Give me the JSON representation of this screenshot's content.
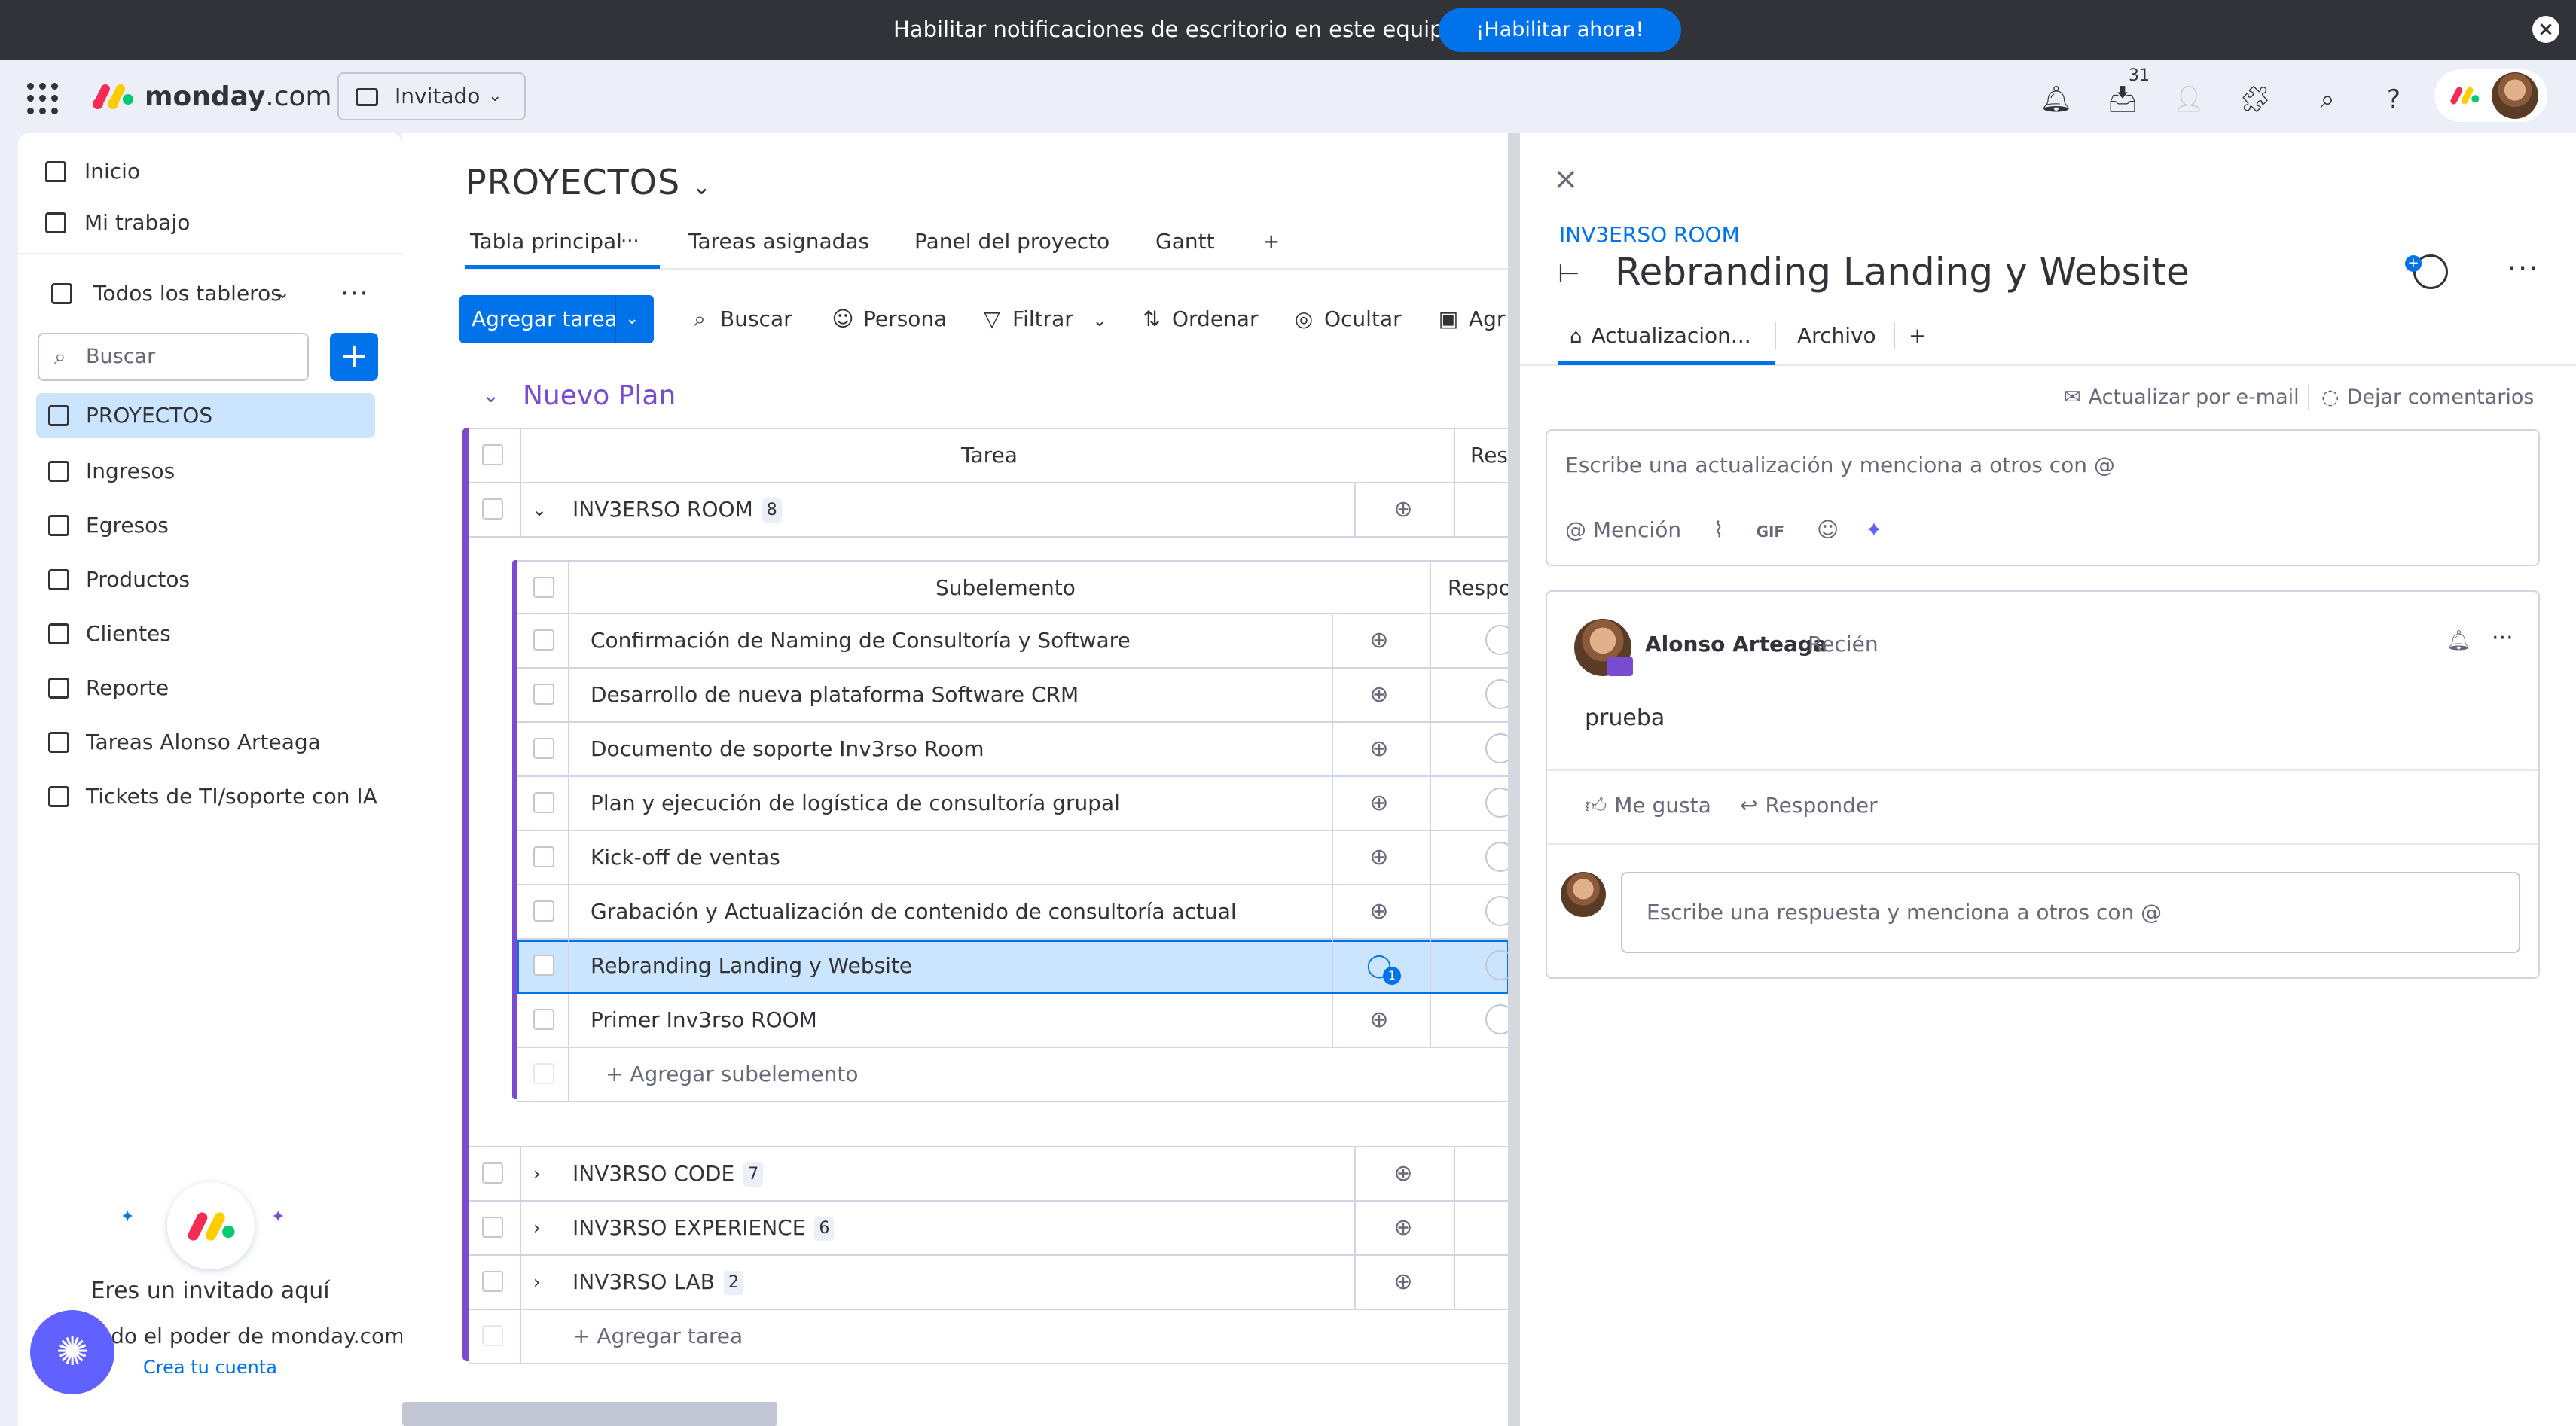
{
  "banner": {
    "message": "Habilitar notificaciones de escritorio en este equipo",
    "cta": "¡Habilitar ahora!"
  },
  "header": {
    "logo": "monday",
    "logo_suffix": ".com",
    "workspace": "Invitado",
    "inbox_count": "31"
  },
  "sidebar": {
    "home": "Inicio",
    "my_work": "Mi trabajo",
    "boards_selector": "Todos los tableros",
    "search_placeholder": "Buscar",
    "items": [
      "PROYECTOS",
      "Ingresos",
      "Egresos",
      "Productos",
      "Clientes",
      "Reporte",
      "Tareas Alonso Arteaga",
      "Tickets de TI/soporte con IA"
    ],
    "guest_line1": "Eres un invitado aquí",
    "guest_line2": "odo el poder de monday.com",
    "guest_link": "Crea tu cuenta"
  },
  "board": {
    "title": "PROYECTOS",
    "tabs": [
      "Tabla principal",
      "Tareas asignadas",
      "Panel del proyecto",
      "Gantt"
    ],
    "toolbar": {
      "add_task": "Agregar tarea",
      "search": "Buscar",
      "person": "Persona",
      "filter": "Filtrar",
      "sort": "Ordenar",
      "hide": "Ocultar",
      "group": "Agr"
    },
    "group_title": "Nuevo Plan",
    "col_task": "Tarea",
    "col_resp": "Res",
    "col_subitem": "Subelemento",
    "col_subresp": "Respo",
    "parent": {
      "name": "INV3ERSO ROOM",
      "count": "8"
    },
    "subitems": [
      "Confirmación de Naming de Consultoría y Software",
      "Desarrollo de nueva plataforma Software CRM",
      "Documento de soporte Inv3rso Room",
      "Plan y ejecución de logística de consultoría grupal",
      "Kick-off de ventas",
      "Grabación y Actualización de contenido de consultoría actual",
      "Rebranding Landing y Website",
      "Primer Inv3rso ROOM"
    ],
    "add_subitem": "+ Agregar subelemento",
    "other_items": [
      {
        "name": "INV3RSO CODE",
        "count": "7"
      },
      {
        "name": "INV3RSO EXPERIENCE",
        "count": "6"
      },
      {
        "name": "INV3RSO LAB",
        "count": "2"
      }
    ],
    "add_task_row": "+ Agregar tarea",
    "update_badge": "1"
  },
  "panel": {
    "breadcrumb": "INV3ERSO ROOM",
    "title": "Rebranding Landing y Website",
    "tabs": [
      "Actualizacion...",
      "Archivo"
    ],
    "email_update": "Actualizar por e-mail",
    "leave_feedback": "Dejar comentarios",
    "editor_placeholder": "Escribe una actualización y menciona a otros con @",
    "mention": "Mención",
    "gif": "GIF",
    "post": {
      "author": "Alonso Arteaga",
      "time": "Recién",
      "body": "prueba",
      "like": "Me gusta",
      "reply": "Responder"
    },
    "reply_placeholder": "Escribe una respuesta y menciona a otros con @"
  },
  "colors": {
    "accent": "#0073ea",
    "group": "#784bd1",
    "selected_row": "#cce5ff"
  }
}
